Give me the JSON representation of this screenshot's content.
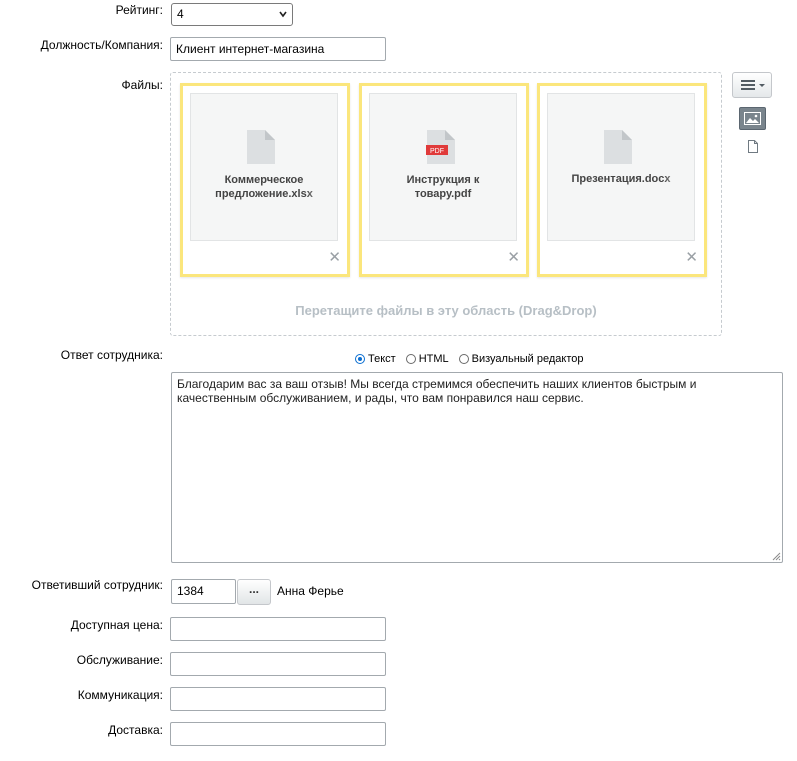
{
  "rating": {
    "label": "Рейтинг:",
    "value": "4"
  },
  "position": {
    "label": "Должность/Компания:",
    "value": "Клиент интернет-магазина"
  },
  "files": {
    "label": "Файлы:",
    "items": [
      {
        "name_line1": "Коммерческое",
        "name_line2": "предложение.xlsx",
        "icon": "xlsx-file-icon"
      },
      {
        "name_line1": "Инструкция к",
        "name_line2": "товару.pdf",
        "icon": "pdf-file-icon",
        "badge": "PDF"
      },
      {
        "name_line1": "Презентация.docx",
        "name_line2": "",
        "icon": "docx-file-icon"
      }
    ],
    "drop_hint": "Перетащите файлы в эту область (Drag&Drop)"
  },
  "response": {
    "label": "Ответ сотрудника:",
    "modes": [
      "Текст",
      "HTML",
      "Визуальный редактор"
    ],
    "selected_mode": "Текст",
    "text": "Благодарим вас за ваш отзыв! Мы всегда стремимся обеспечить наших клиентов быстрым и качественным обслуживанием, и рады, что вам понравился наш сервис."
  },
  "responder": {
    "label": "Ответивший сотрудник:",
    "id": "1384",
    "button": "...",
    "name": "Анна Ферье"
  },
  "fields": {
    "price": {
      "label": "Доступная цена:",
      "value": ""
    },
    "service": {
      "label": "Обслуживание:",
      "value": ""
    },
    "communication": {
      "label": "Коммуникация:",
      "value": ""
    },
    "delivery": {
      "label": "Доставка:",
      "value": ""
    }
  },
  "colors": {
    "file_border": "#fbe67c",
    "radio_accent": "#0a6ed1",
    "pdf_badge": "#e03a3a"
  }
}
